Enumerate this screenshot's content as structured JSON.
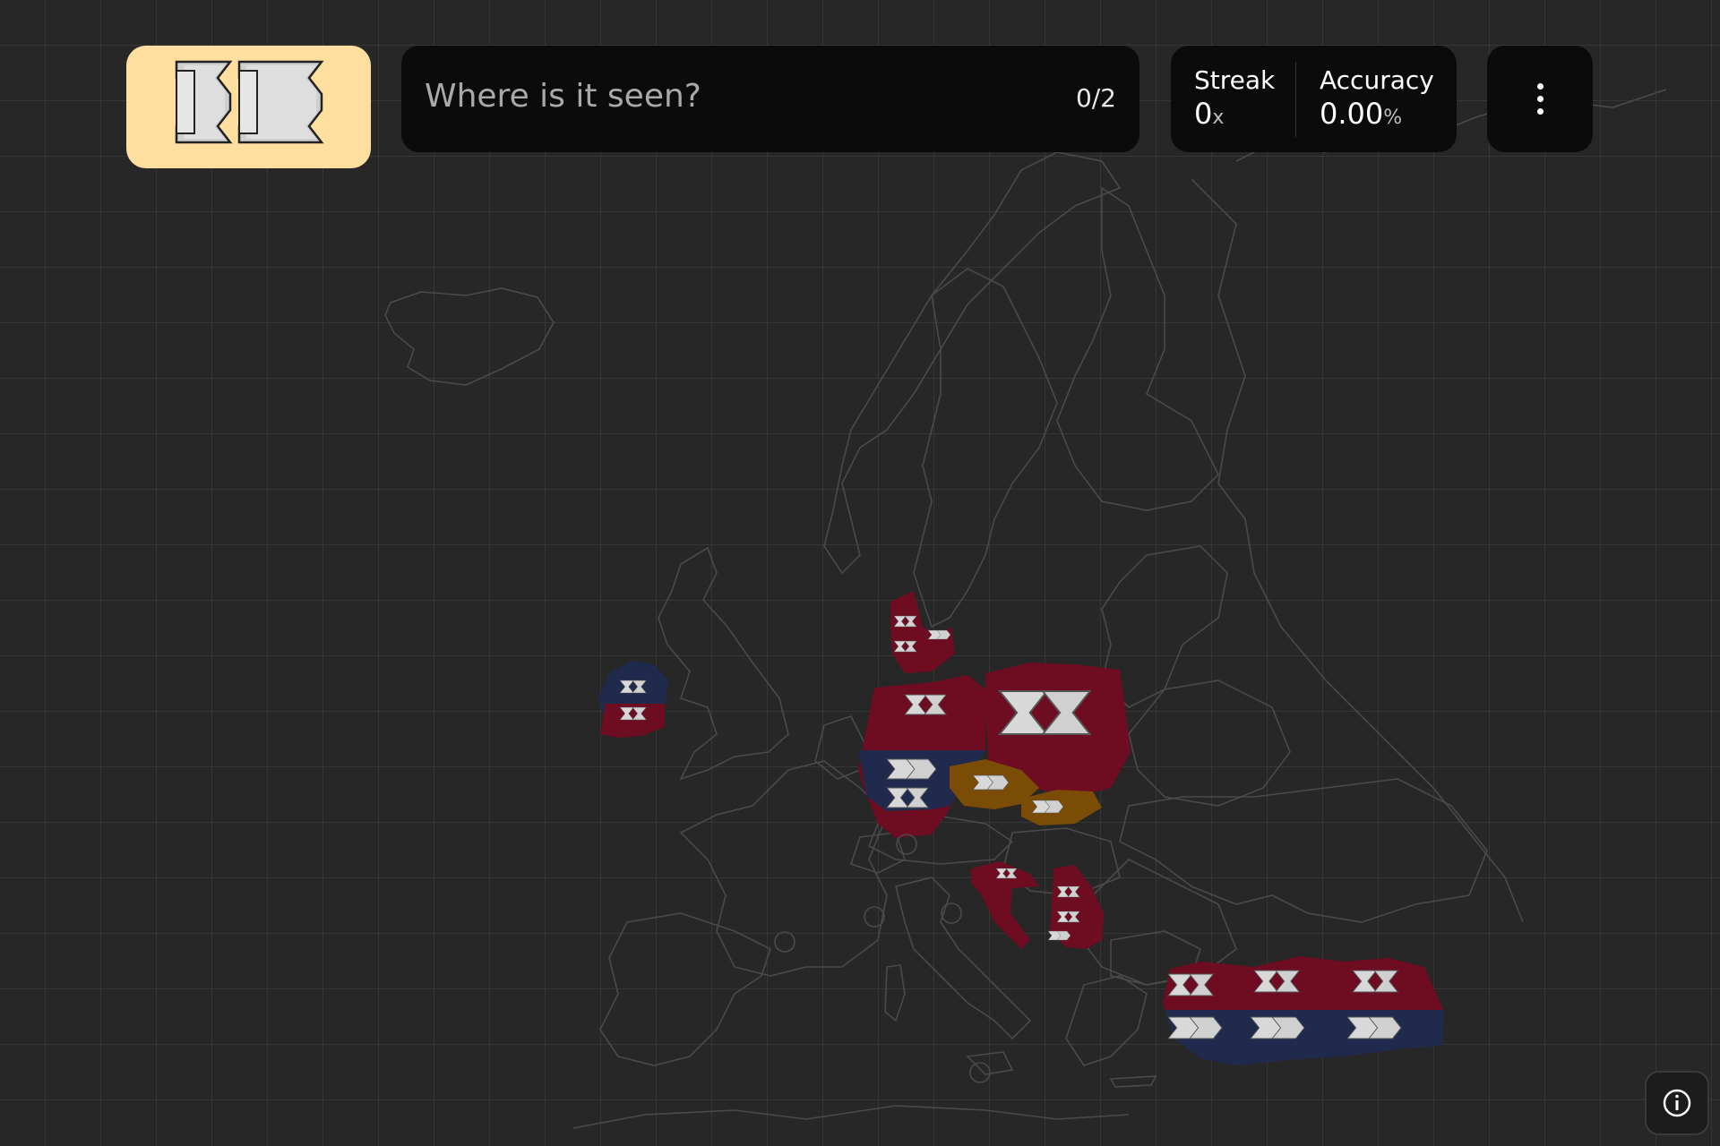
{
  "question": {
    "prompt": "Where is it seen?",
    "progress": "0/2"
  },
  "stats": {
    "streak_label": "Streak",
    "streak_value": "0",
    "streak_suffix": "x",
    "accuracy_label": "Accuracy",
    "accuracy_value": "0.00",
    "accuracy_suffix": "%"
  },
  "sign_card": {
    "icon": "chevron-alignment-sign",
    "background": "#ffdf9f"
  },
  "menu": {
    "icon": "more-vertical-icon"
  },
  "info": {
    "icon": "info-icon"
  },
  "map": {
    "region": "Europe",
    "background": "#272727",
    "grid_color": "#3a3a3a",
    "highlight_colors": {
      "red": "#6e0c22",
      "navy": "#1f2a4d",
      "brown": "#7a4c06"
    },
    "highlighted_countries": [
      "Ireland",
      "Denmark",
      "Germany",
      "Poland",
      "Czechia",
      "Slovakia",
      "Croatia",
      "Serbia",
      "Turkey"
    ]
  }
}
